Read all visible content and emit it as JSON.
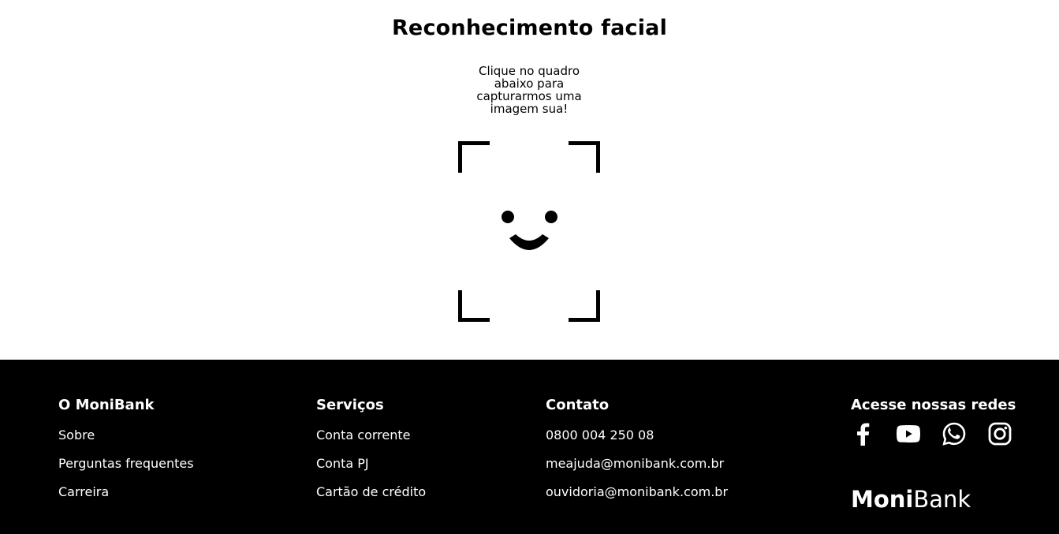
{
  "page": {
    "title": "Reconhecimento facial",
    "instructions": "Clique no quadro abaixo para capturarmos uma imagem sua!"
  },
  "capture": {
    "icon": "face-frame-icon",
    "accent_color": "#000000"
  },
  "footer": {
    "background_color": "#000000",
    "text_color": "#ffffff",
    "monibank": {
      "heading": "O MoniBank",
      "links": [
        "Sobre",
        "Perguntas frequentes",
        "Carreira"
      ]
    },
    "servicos": {
      "heading": "Serviços",
      "links": [
        "Conta corrente",
        "Conta PJ",
        "Cartão de crédito"
      ]
    },
    "contato": {
      "heading": "Contato",
      "links": [
        "0800 004 250 08",
        "meajuda@monibank.com.br",
        "ouvidoria@monibank.com.br"
      ]
    },
    "redes": {
      "heading": "Acesse nossas redes",
      "icons": [
        "facebook-icon",
        "youtube-icon",
        "whatsapp-icon",
        "instagram-icon"
      ]
    },
    "logo": {
      "bold": "Moni",
      "light": "Bank"
    }
  }
}
